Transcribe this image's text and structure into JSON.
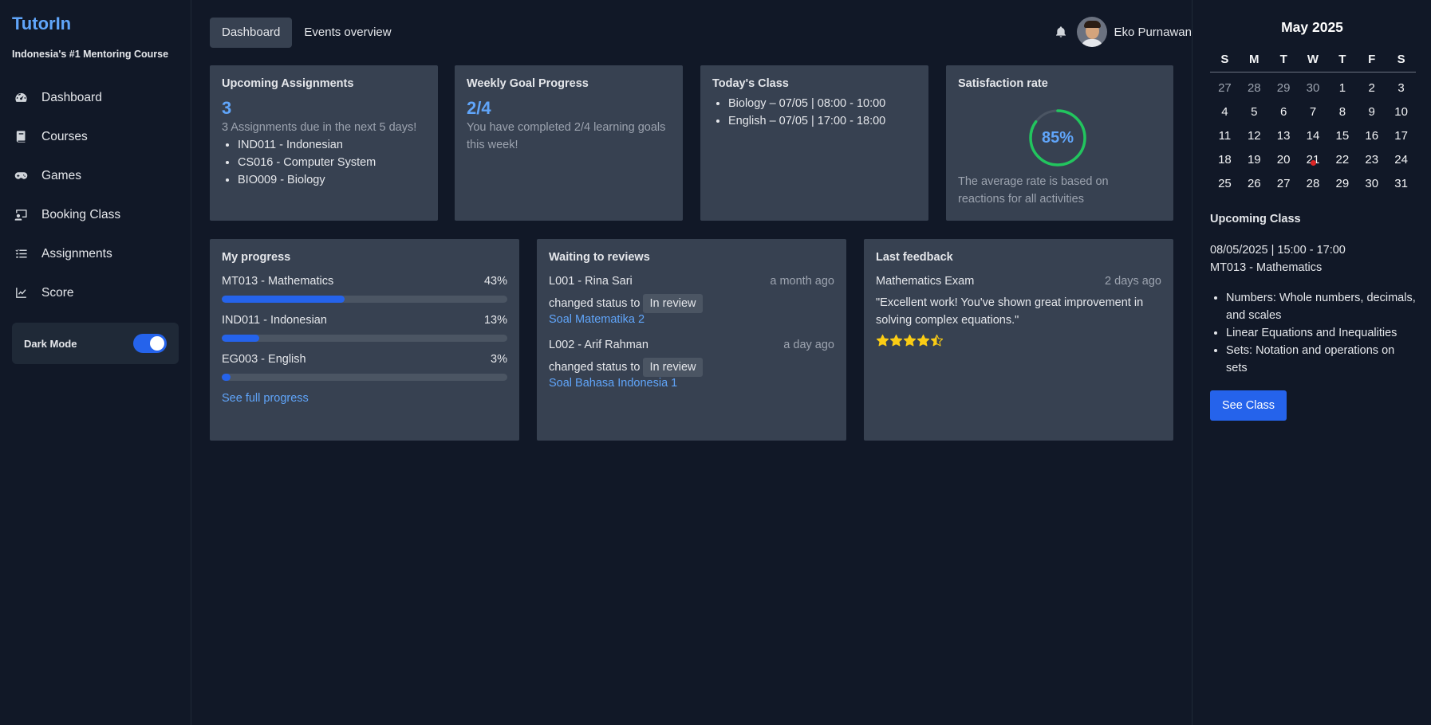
{
  "sidebar": {
    "brand": "TutorIn",
    "tagline": "Indonesia's #1 Mentoring Course",
    "items": [
      {
        "label": "Dashboard",
        "icon": "gauge-icon"
      },
      {
        "label": "Courses",
        "icon": "book-icon"
      },
      {
        "label": "Games",
        "icon": "gamepad-icon"
      },
      {
        "label": "Booking Class",
        "icon": "chalkboard-icon"
      },
      {
        "label": "Assignments",
        "icon": "list-check-icon"
      },
      {
        "label": "Score",
        "icon": "chart-line-icon"
      }
    ],
    "dark_mode_label": "Dark Mode",
    "dark_mode_on": true
  },
  "header": {
    "tabs": [
      {
        "label": "Dashboard",
        "active": true
      },
      {
        "label": "Events overview",
        "active": false
      }
    ],
    "user_name": "Eko Purnawan"
  },
  "cards": {
    "upcoming": {
      "title": "Upcoming Assignments",
      "count": "3",
      "subtitle": "3 Assignments due in the next 5 days!",
      "items": [
        "IND011 - Indonesian",
        "CS016 - Computer System",
        "BIO009 - Biology"
      ]
    },
    "weekly": {
      "title": "Weekly Goal Progress",
      "value": "2/4",
      "subtitle": "You have completed 2/4 learning goals this week!"
    },
    "today": {
      "title": "Today's Class",
      "items": [
        "Biology – 07/05 | 08:00 - 10:00",
        "English – 07/05 | 17:00 - 18:00"
      ]
    },
    "satisfaction": {
      "title": "Satisfaction rate",
      "value_text": "85%",
      "value": 0.85,
      "description": "The average rate is based on reactions for all activities"
    },
    "progress": {
      "title": "My progress",
      "rows": [
        {
          "name": "MT013 - Mathematics",
          "pct_text": "43%",
          "pct": 0.43
        },
        {
          "name": "IND011 - Indonesian",
          "pct_text": "13%",
          "pct": 0.13
        },
        {
          "name": "EG003 - English",
          "pct_text": "3%",
          "pct": 0.03
        }
      ],
      "link": "See full progress"
    },
    "reviews": {
      "title": "Waiting to reviews",
      "items": [
        {
          "who": "L001 - Rina Sari",
          "time": "a month ago",
          "status_prefix": "changed status to",
          "status": "In review",
          "link": "Soal Matematika 2"
        },
        {
          "who": "L002 - Arif Rahman",
          "time": "a day ago",
          "status_prefix": "changed status to",
          "status": "In review",
          "link": "Soal Bahasa Indonesia 1"
        }
      ]
    },
    "feedback": {
      "title": "Last feedback",
      "subject": "Mathematics Exam",
      "time": "2 days ago",
      "quote": "\"Excellent work! You've shown great improvement in solving complex equations.\"",
      "rating": 4.5,
      "star_color": "#facc15"
    }
  },
  "calendar": {
    "title": "May 2025",
    "weekdays": [
      "S",
      "M",
      "T",
      "W",
      "T",
      "F",
      "S"
    ],
    "weeks": [
      [
        "27",
        "28",
        "29",
        "30",
        "1",
        "2",
        "3"
      ],
      [
        "4",
        "5",
        "6",
        "7",
        "8",
        "9",
        "10"
      ],
      [
        "11",
        "12",
        "13",
        "14",
        "15",
        "16",
        "17"
      ],
      [
        "18",
        "19",
        "20",
        "21",
        "22",
        "23",
        "24"
      ],
      [
        "25",
        "26",
        "27",
        "28",
        "29",
        "30",
        "31"
      ]
    ],
    "today": "21"
  },
  "upcoming_class": {
    "title": "Upcoming Class",
    "datetime": "08/05/2025 | 15:00 - 17:00",
    "course": "MT013 - Mathematics",
    "topics": [
      "Numbers: Whole numbers, decimals, and scales",
      "Linear Equations and Inequalities",
      "Sets: Notation and operations on sets"
    ],
    "button": "See Class"
  },
  "colors": {
    "accent": "#2563eb",
    "link": "#60a5fa",
    "ring": "#22c55e",
    "card_bg": "#374151",
    "page_bg": "#111827"
  }
}
